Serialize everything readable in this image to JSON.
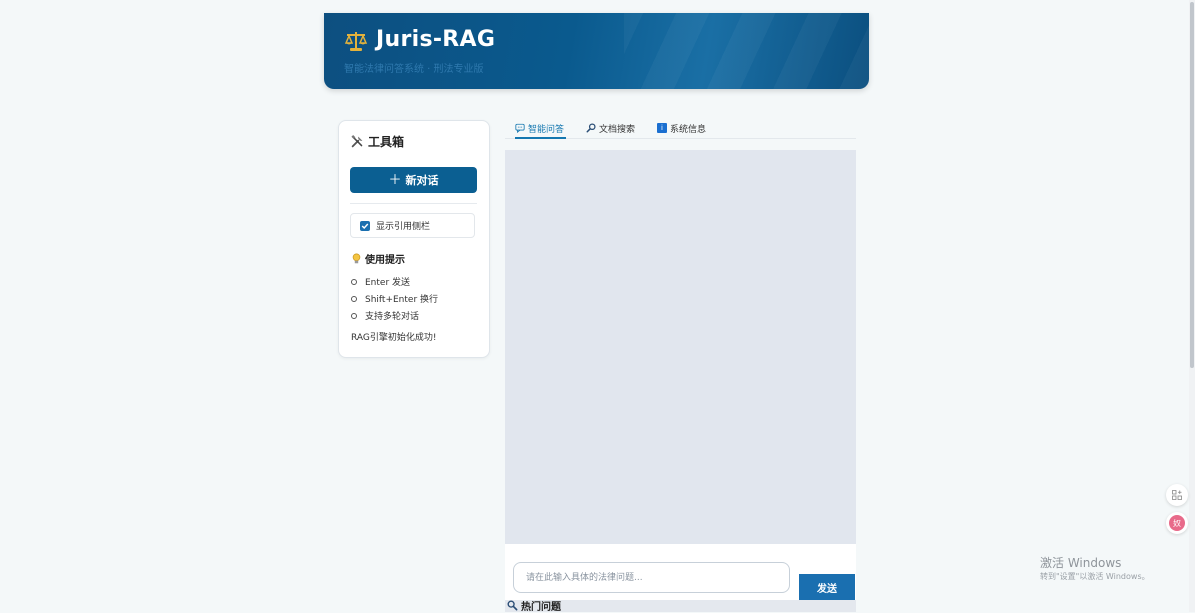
{
  "header": {
    "icon": "scales-icon",
    "title": "Juris-RAG",
    "subtitle": "智能法律问答系统 · 刑法专业版"
  },
  "sidebar": {
    "title": "工具箱",
    "title_icon": "tools-icon",
    "new_chat_label": "新对话",
    "citation_toggle": {
      "label": "显示引用侧栏",
      "checked": true
    },
    "tips_title": "使用提示",
    "tips_icon": "lightbulb-icon",
    "tips": [
      "Enter 发送",
      "Shift+Enter 换行",
      "支持多轮对话"
    ],
    "status": "RAG引擎初始化成功!"
  },
  "tabs": [
    {
      "label": "智能问答",
      "icon": "chat-icon",
      "active": true
    },
    {
      "label": "文档搜索",
      "icon": "search-icon",
      "active": false
    },
    {
      "label": "系统信息",
      "icon": "info-icon",
      "active": false
    }
  ],
  "chat": {
    "input_placeholder": "请在此输入具体的法律问题...",
    "send_label": "发送",
    "hot_title": "热门问题"
  },
  "floating": {
    "badge_b": "奴"
  },
  "watermark": {
    "title": "激活 Windows",
    "subtitle": "转到\"设置\"以激活 Windows。"
  },
  "colors": {
    "primary": "#0b5f92",
    "accent": "#1477b0",
    "chat_bg": "#e1e6ee"
  }
}
